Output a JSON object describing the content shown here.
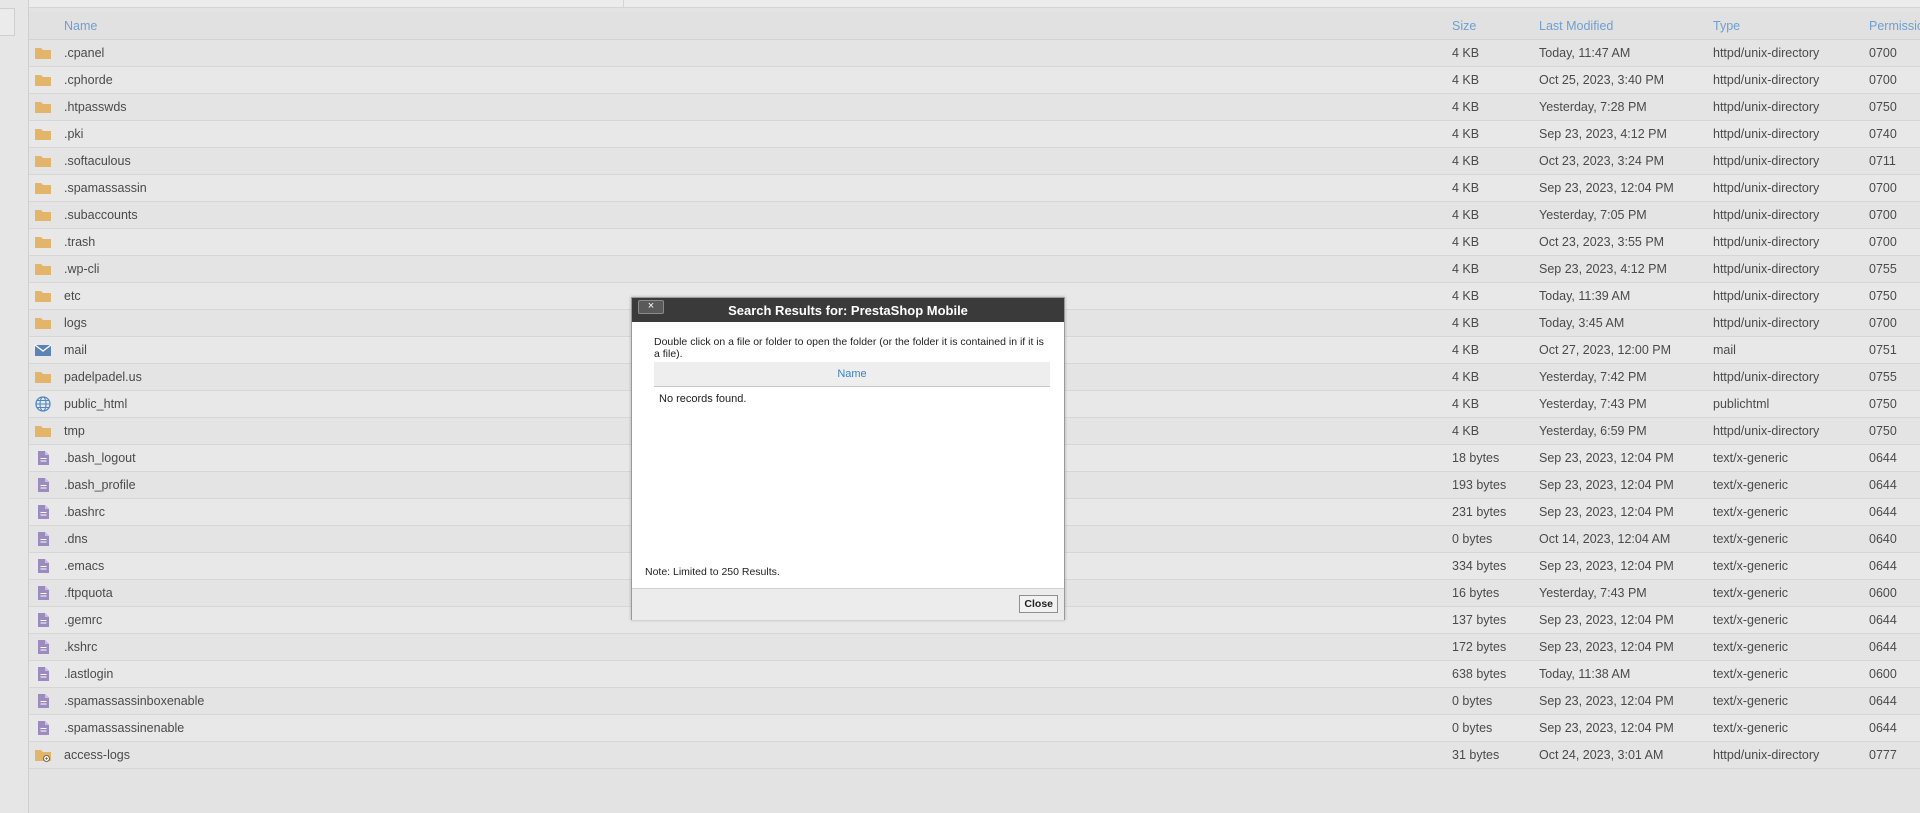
{
  "columns": {
    "name": "Name",
    "size": "Size",
    "modified": "Last Modified",
    "type": "Type",
    "perms": "Permissions"
  },
  "files": [
    {
      "icon": "folder-icon",
      "name": ".cpanel",
      "size": "4 KB",
      "modified": "Today, 11:47 AM",
      "type": "httpd/unix-directory",
      "perms": "0700"
    },
    {
      "icon": "folder-icon",
      "name": ".cphorde",
      "size": "4 KB",
      "modified": "Oct 25, 2023, 3:40 PM",
      "type": "httpd/unix-directory",
      "perms": "0700"
    },
    {
      "icon": "folder-icon",
      "name": ".htpasswds",
      "size": "4 KB",
      "modified": "Yesterday, 7:28 PM",
      "type": "httpd/unix-directory",
      "perms": "0750"
    },
    {
      "icon": "folder-icon",
      "name": ".pki",
      "size": "4 KB",
      "modified": "Sep 23, 2023, 4:12 PM",
      "type": "httpd/unix-directory",
      "perms": "0740"
    },
    {
      "icon": "folder-icon",
      "name": ".softaculous",
      "size": "4 KB",
      "modified": "Oct 23, 2023, 3:24 PM",
      "type": "httpd/unix-directory",
      "perms": "0711"
    },
    {
      "icon": "folder-icon",
      "name": ".spamassassin",
      "size": "4 KB",
      "modified": "Sep 23, 2023, 12:04 PM",
      "type": "httpd/unix-directory",
      "perms": "0700"
    },
    {
      "icon": "folder-icon",
      "name": ".subaccounts",
      "size": "4 KB",
      "modified": "Yesterday, 7:05 PM",
      "type": "httpd/unix-directory",
      "perms": "0700"
    },
    {
      "icon": "folder-icon",
      "name": ".trash",
      "size": "4 KB",
      "modified": "Oct 23, 2023, 3:55 PM",
      "type": "httpd/unix-directory",
      "perms": "0700"
    },
    {
      "icon": "folder-icon",
      "name": ".wp-cli",
      "size": "4 KB",
      "modified": "Sep 23, 2023, 4:12 PM",
      "type": "httpd/unix-directory",
      "perms": "0755"
    },
    {
      "icon": "folder-icon",
      "name": "etc",
      "size": "4 KB",
      "modified": "Today, 11:39 AM",
      "type": "httpd/unix-directory",
      "perms": "0750"
    },
    {
      "icon": "folder-icon",
      "name": "logs",
      "size": "4 KB",
      "modified": "Today, 3:45 AM",
      "type": "httpd/unix-directory",
      "perms": "0700"
    },
    {
      "icon": "mail-icon",
      "name": "mail",
      "size": "4 KB",
      "modified": "Oct 27, 2023, 12:00 PM",
      "type": "mail",
      "perms": "0751"
    },
    {
      "icon": "folder-icon",
      "name": "padelpadel.us",
      "size": "4 KB",
      "modified": "Yesterday, 7:42 PM",
      "type": "httpd/unix-directory",
      "perms": "0755"
    },
    {
      "icon": "globe-icon",
      "name": "public_html",
      "size": "4 KB",
      "modified": "Yesterday, 7:43 PM",
      "type": "publichtml",
      "perms": "0750"
    },
    {
      "icon": "folder-icon",
      "name": "tmp",
      "size": "4 KB",
      "modified": "Yesterday, 6:59 PM",
      "type": "httpd/unix-directory",
      "perms": "0750"
    },
    {
      "icon": "file-icon",
      "name": ".bash_logout",
      "size": "18 bytes",
      "modified": "Sep 23, 2023, 12:04 PM",
      "type": "text/x-generic",
      "perms": "0644"
    },
    {
      "icon": "file-icon",
      "name": ".bash_profile",
      "size": "193 bytes",
      "modified": "Sep 23, 2023, 12:04 PM",
      "type": "text/x-generic",
      "perms": "0644"
    },
    {
      "icon": "file-icon",
      "name": ".bashrc",
      "size": "231 bytes",
      "modified": "Sep 23, 2023, 12:04 PM",
      "type": "text/x-generic",
      "perms": "0644"
    },
    {
      "icon": "file-icon",
      "name": ".dns",
      "size": "0 bytes",
      "modified": "Oct 14, 2023, 12:04 AM",
      "type": "text/x-generic",
      "perms": "0640"
    },
    {
      "icon": "file-icon",
      "name": ".emacs",
      "size": "334 bytes",
      "modified": "Sep 23, 2023, 12:04 PM",
      "type": "text/x-generic",
      "perms": "0644"
    },
    {
      "icon": "file-icon",
      "name": ".ftpquota",
      "size": "16 bytes",
      "modified": "Yesterday, 7:43 PM",
      "type": "text/x-generic",
      "perms": "0600"
    },
    {
      "icon": "file-icon",
      "name": ".gemrc",
      "size": "137 bytes",
      "modified": "Sep 23, 2023, 12:04 PM",
      "type": "text/x-generic",
      "perms": "0644"
    },
    {
      "icon": "file-icon",
      "name": ".kshrc",
      "size": "172 bytes",
      "modified": "Sep 23, 2023, 12:04 PM",
      "type": "text/x-generic",
      "perms": "0644"
    },
    {
      "icon": "file-icon",
      "name": ".lastlogin",
      "size": "638 bytes",
      "modified": "Today, 11:38 AM",
      "type": "text/x-generic",
      "perms": "0600"
    },
    {
      "icon": "file-icon",
      "name": ".spamassassinboxenable",
      "size": "0 bytes",
      "modified": "Sep 23, 2023, 12:04 PM",
      "type": "text/x-generic",
      "perms": "0644"
    },
    {
      "icon": "file-icon",
      "name": ".spamassassinenable",
      "size": "0 bytes",
      "modified": "Sep 23, 2023, 12:04 PM",
      "type": "text/x-generic",
      "perms": "0644"
    },
    {
      "icon": "folder-link-icon",
      "name": "access-logs",
      "size": "31 bytes",
      "modified": "Oct 24, 2023, 3:01 AM",
      "type": "httpd/unix-directory",
      "perms": "0777"
    }
  ],
  "dialog": {
    "title": "Search Results for: PrestaShop Mobile",
    "close_x": "×",
    "instructions": "Double click on a file or folder to open the folder (or the folder it is contained in if it is a file).",
    "results_header": "Name",
    "empty_message": "No records found.",
    "note": "Note: Limited to 250 Results.",
    "close_label": "Close"
  },
  "colors": {
    "folder": "#e3b56a",
    "file": "#9b8bbf",
    "mail": "#5b83b8",
    "globe": "#4f86c6",
    "link": "#7a6a55",
    "accent": "#3b82c4",
    "header_text": "#6f9fd1"
  }
}
